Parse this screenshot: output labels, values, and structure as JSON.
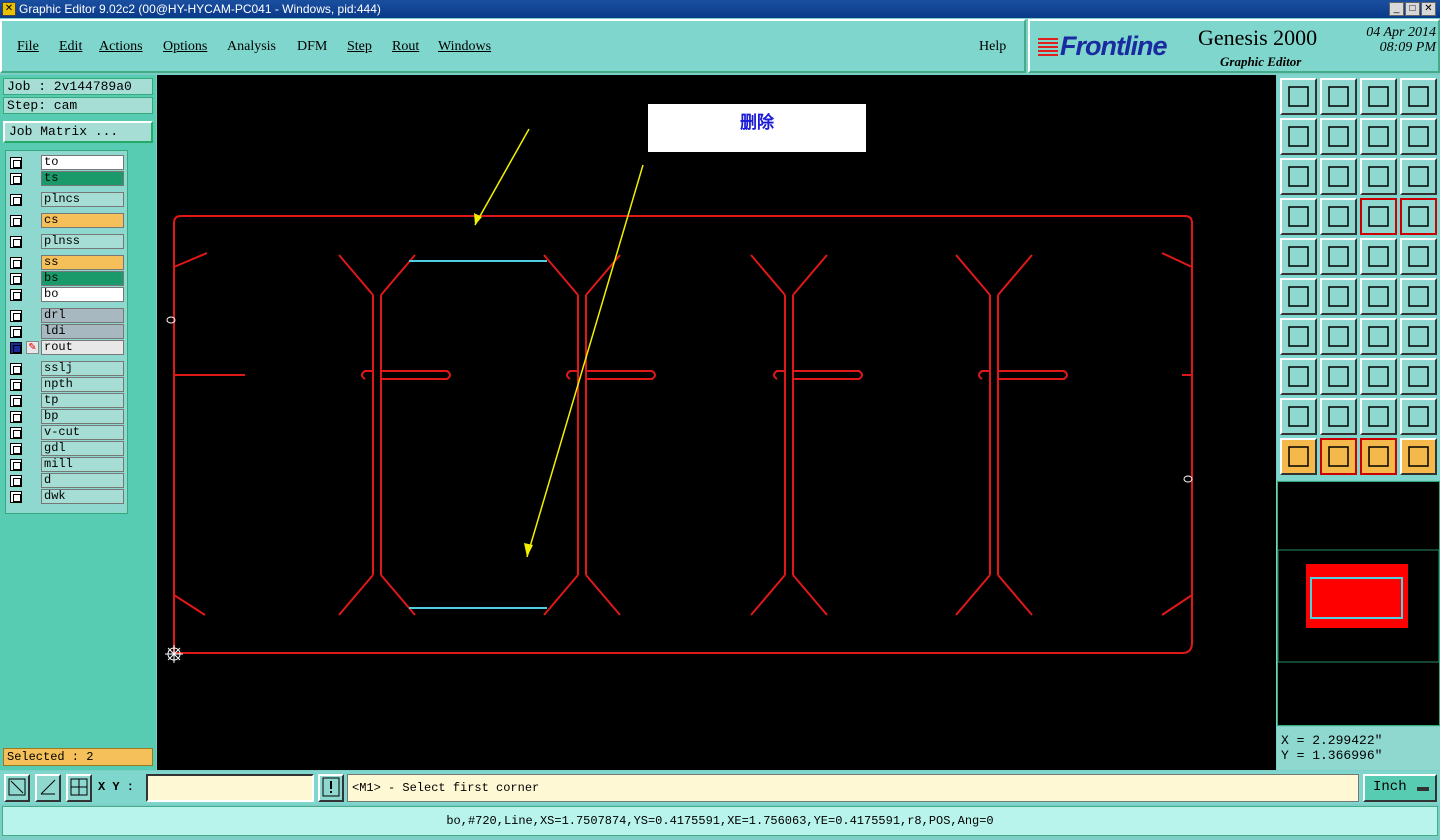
{
  "window": {
    "title": "Graphic Editor 9.02c2 (00@HY-HYCAM-PC041 - Windows, pid:444)"
  },
  "menu": {
    "items": [
      "File",
      "Edit",
      "Actions",
      "Options",
      "Analysis",
      "DFM",
      "Step",
      "Rout",
      "Windows"
    ],
    "help": "Help"
  },
  "brand": {
    "logo": "Frontline",
    "product": "Genesis 2000",
    "subtitle": "Graphic Editor",
    "date": "04 Apr 2014",
    "time": "08:09 PM"
  },
  "job": {
    "job_label": "Job : 2v144789a0",
    "step_label": "Step: cam",
    "matrix_button": "Job Matrix ..."
  },
  "layers": [
    {
      "name": "to",
      "color": "#ffffff"
    },
    {
      "name": "ts",
      "color": "#1a9a6a"
    },
    {
      "name": "plncs",
      "color": "#a6ddd5"
    },
    {
      "name": "cs",
      "color": "#f5c05a"
    },
    {
      "name": "plnss",
      "color": "#a6ddd5"
    },
    {
      "name": "ss",
      "color": "#f5c05a"
    },
    {
      "name": "bs",
      "color": "#1a9a6a"
    },
    {
      "name": "bo",
      "color": "#ffffff"
    },
    {
      "name": "drl",
      "color": "#a8b8c0"
    },
    {
      "name": "ldi",
      "color": "#a8b8c0"
    },
    {
      "name": "rout",
      "color": "#e8e8e8"
    },
    {
      "name": "sslj",
      "color": "#a6ddd5"
    },
    {
      "name": "npth",
      "color": "#a6ddd5"
    },
    {
      "name": "tp",
      "color": "#a6ddd5"
    },
    {
      "name": "bp",
      "color": "#a6ddd5"
    },
    {
      "name": "v-cut",
      "color": "#a6ddd5"
    },
    {
      "name": "gdl",
      "color": "#a6ddd5"
    },
    {
      "name": "mill",
      "color": "#a6ddd5"
    },
    {
      "name": "d",
      "color": "#a6ddd5"
    },
    {
      "name": "dwk",
      "color": "#a6ddd5"
    }
  ],
  "selected": "Selected : 2",
  "canvas": {
    "callout": "删除"
  },
  "coords": {
    "x": "X = 2.299422\"",
    "y": "Y = 1.366996\""
  },
  "bottom": {
    "xy_label": "X Y :",
    "xy_value": "",
    "prompt": "<M1> - Select first corner",
    "units": "Inch"
  },
  "status": "bo,#720,Line,XS=1.7507874,YS=0.4175591,XE=1.756063,YE=0.4175591,r8,POS,Ang=0",
  "colors": {
    "panel": "#57ccb2",
    "rout_red": "#e01818",
    "highlight_cyan": "#4fd0e0",
    "arrow_yellow": "#f0f000"
  }
}
